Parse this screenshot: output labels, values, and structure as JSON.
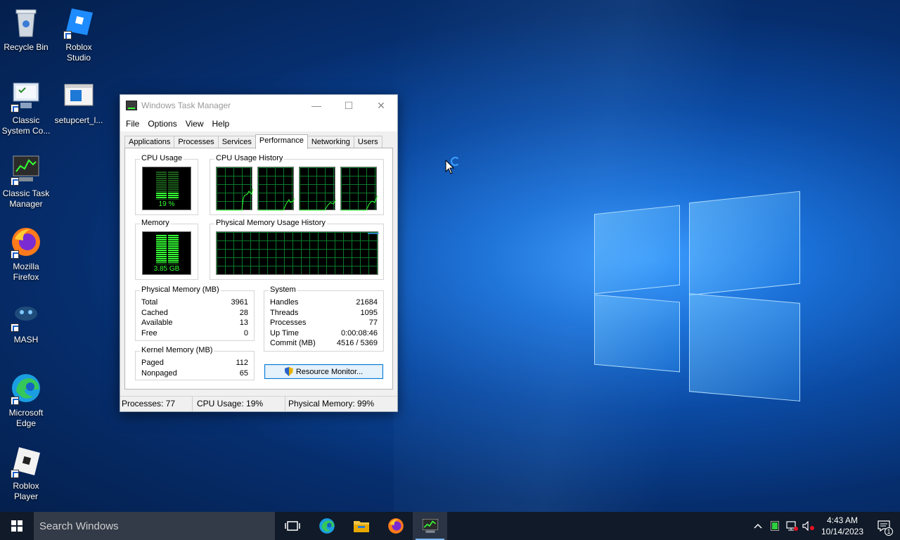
{
  "desktop": {
    "icons": [
      {
        "label": "Recycle Bin",
        "icon": "recycle-bin-icon"
      },
      {
        "label": "Roblox Studio",
        "icon": "roblox-studio-icon"
      },
      {
        "label": "Classic System Co...",
        "icon": "control-panel-icon"
      },
      {
        "label": "setupcert_l...",
        "icon": "setupcert-icon"
      },
      {
        "label": "Classic Task Manager",
        "icon": "task-manager-icon"
      },
      {
        "label": "Mozilla Firefox",
        "icon": "firefox-icon"
      },
      {
        "label": "MASH",
        "icon": "mash-icon"
      },
      {
        "label": "Microsoft Edge",
        "icon": "edge-icon"
      },
      {
        "label": "Roblox Player",
        "icon": "roblox-player-icon"
      }
    ]
  },
  "taskmanager": {
    "title": "Windows Task Manager",
    "menu": [
      "File",
      "Options",
      "View",
      "Help"
    ],
    "tabs": [
      "Applications",
      "Processes",
      "Services",
      "Performance",
      "Networking",
      "Users"
    ],
    "active_tab": "Performance",
    "cpu_usage_label": "CPU Usage",
    "cpu_usage_value": "19 %",
    "cpu_usage_fraction": 0.19,
    "cpu_history_label": "CPU Usage History",
    "memory_label": "Memory",
    "memory_value": "3.85 GB",
    "memory_fraction": 0.99,
    "mem_history_label": "Physical Memory Usage History",
    "physical_memory": {
      "title": "Physical Memory (MB)",
      "rows": [
        {
          "label": "Total",
          "value": "3961"
        },
        {
          "label": "Cached",
          "value": "28"
        },
        {
          "label": "Available",
          "value": "13"
        },
        {
          "label": "Free",
          "value": "0"
        }
      ]
    },
    "kernel_memory": {
      "title": "Kernel Memory (MB)",
      "rows": [
        {
          "label": "Paged",
          "value": "112"
        },
        {
          "label": "Nonpaged",
          "value": "65"
        }
      ]
    },
    "system": {
      "title": "System",
      "rows": [
        {
          "label": "Handles",
          "value": "21684"
        },
        {
          "label": "Threads",
          "value": "1095"
        },
        {
          "label": "Processes",
          "value": "77"
        },
        {
          "label": "Up Time",
          "value": "0:00:08:46"
        },
        {
          "label": "Commit (MB)",
          "value": "4516 / 5369"
        }
      ]
    },
    "resource_monitor_label": "Resource Monitor...",
    "status": {
      "processes": "Processes: 77",
      "cpu": "CPU Usage: 19%",
      "memory": "Physical Memory: 99%"
    }
  },
  "taskbar": {
    "search_placeholder": "Search Windows",
    "clock_time": "4:43 AM",
    "clock_date": "10/14/2023",
    "notification_count": "1"
  }
}
